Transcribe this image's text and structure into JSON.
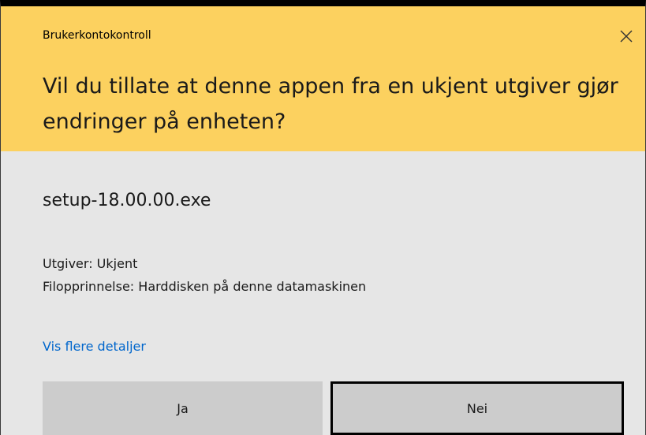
{
  "dialog": {
    "title": "Brukerkontokontroll",
    "question": "Vil du tillate at denne appen fra en ukjent utgiver gjør endringer på enheten?",
    "file_name": "setup-18.00.00.exe",
    "publisher": "Utgiver: Ukjent",
    "file_origin": "Filopprinnelse: Harddisken på denne datamaskinen",
    "details_link": "Vis flere detaljer",
    "yes_label": "Ja",
    "no_label": "Nei",
    "close_icon": "close-icon"
  },
  "colors": {
    "header_bg": "#fcd15f",
    "body_bg": "#e6e6e6",
    "button_bg": "#cccccc",
    "link": "#0066cc"
  }
}
